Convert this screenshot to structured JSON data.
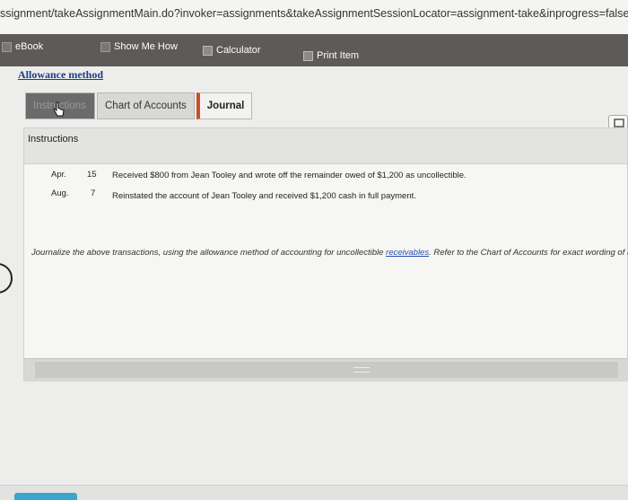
{
  "browser": {
    "url": "ssignment/takeAssignmentMain.do?invoker=assignments&takeAssignmentSessionLocator=assignment-take&inprogress=false"
  },
  "toolbar": {
    "ebook": "eBook",
    "show_me_how": "Show Me How",
    "calculator": "Calculator",
    "print_item": "Print Item"
  },
  "page": {
    "heading": "Allowance method"
  },
  "tabs": [
    {
      "label": "Instructions"
    },
    {
      "label": "Chart of Accounts"
    },
    {
      "label": "Journal"
    }
  ],
  "panel": {
    "title": "Instructions",
    "transactions": [
      {
        "month": "Apr.",
        "day": "15",
        "description": "Received $800 from Jean Tooley and wrote off the remainder owed of $1,200 as uncollectible."
      },
      {
        "month": "Aug.",
        "day": "7",
        "description": "Reinstated the account of Jean Tooley and received $1,200 cash in full payment."
      }
    ],
    "instruction_before": "Journalize the above transactions, using the allowance method of accounting for uncollectible ",
    "instruction_link": "receivables",
    "instruction_after": ". Refer to the Chart of Accounts for exact wording of account title"
  },
  "icons": {
    "cursor": "hand-pointer-icon",
    "edge": "expand-icon"
  }
}
